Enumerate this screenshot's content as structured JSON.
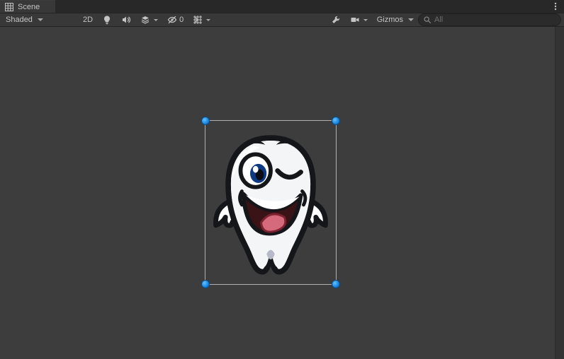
{
  "tab": {
    "label": "Scene"
  },
  "toolbar": {
    "shading_mode": "Shaded",
    "mode2d_label": "2D",
    "hidden_count": "0",
    "gizmos_label": "Gizmos",
    "search_placeholder": "All"
  },
  "sprite": {
    "name": "tooth-character"
  }
}
